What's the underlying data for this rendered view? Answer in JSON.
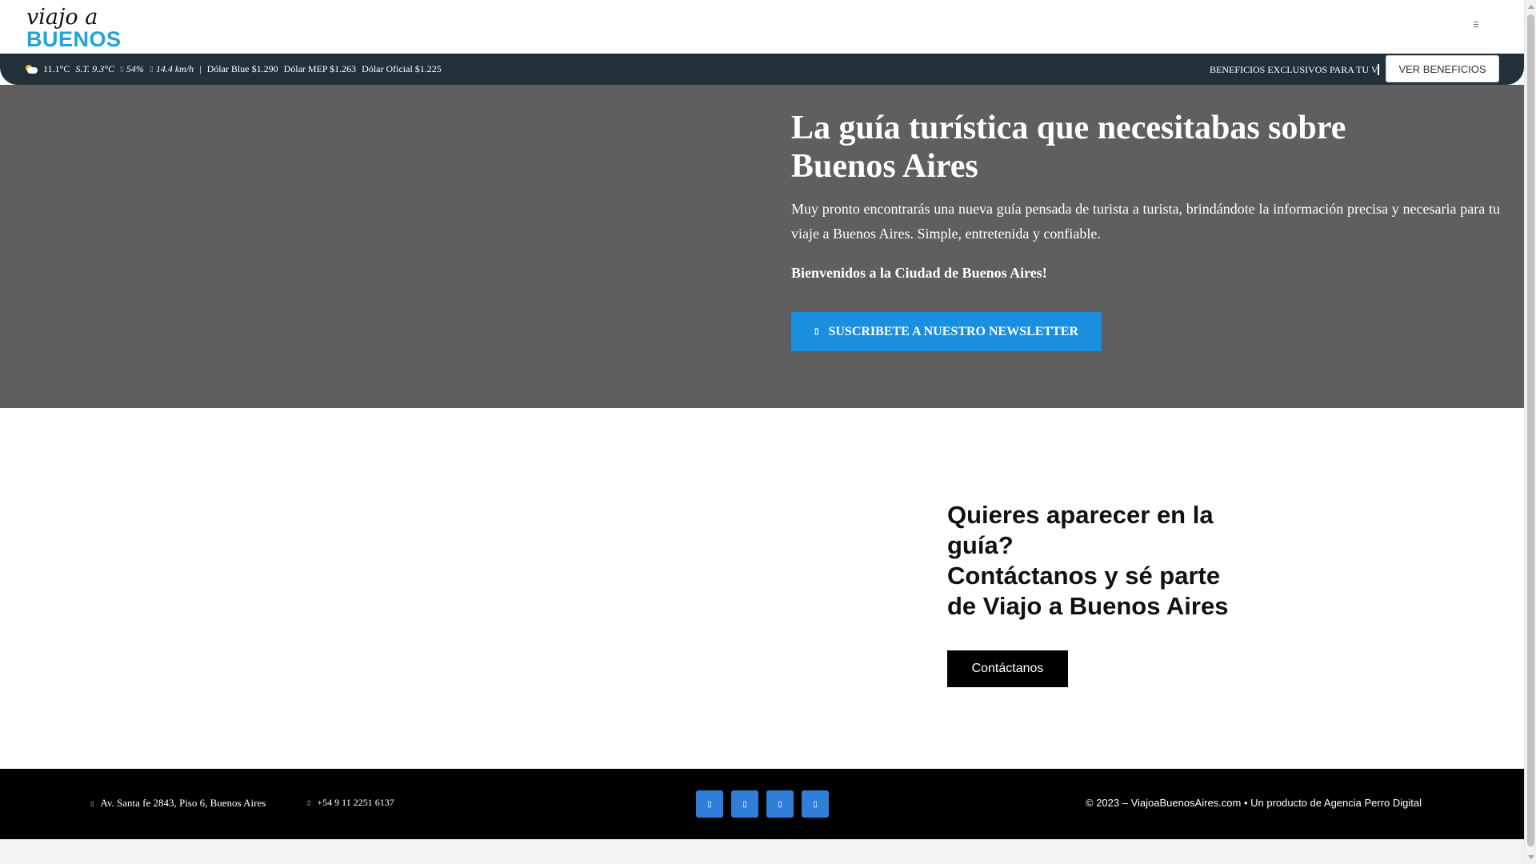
{
  "header": {
    "logo_script": "viajo a",
    "logo_block": "BUENOS AIRES",
    "menu_icon": "hamburger-icon"
  },
  "topbar": {
    "temperature": "11.1°C",
    "feels_like": "S.T. 9.3°C",
    "humidity": "54%",
    "wind": "14.4 km/h",
    "separator": "|",
    "dolar_blue": "Dólar Blue $1.290",
    "dolar_mep": "Dólar MEP $1.263",
    "dolar_oficial": "Dólar Oficial $1.225",
    "ticker_text": "BENEFICIOS EXCLUSIVOS PARA TU VIAJE",
    "cta_label": "VER BENEFICIOS"
  },
  "hero": {
    "title": "La guía turística que necesitabas sobre Buenos Aires",
    "text": "Muy pronto encontrarás una nueva guía pensada de turista a turista, brindándote la información precisa y necesaria para tu viaje a Buenos Aires.  Simple, entretenida y confiable.",
    "welcome": "Bienvenidos a la Ciudad de Buenos Aires!",
    "newsletter_label": "SUSCRIBETE A NUESTRO NEWSLETTER"
  },
  "contact": {
    "title_line1": "Quieres aparecer en la guía?",
    "title_line2": "Contáctanos y sé parte de Viajo a Buenos Aires",
    "button_label": "Contáctanos"
  },
  "footer": {
    "address": "Av. Santa fe 2843, Piso 6, Buenos Aires",
    "phone": "+54 9 11 2251 6137",
    "socials": [
      "facebook-icon",
      "instagram-icon",
      "twitter-icon",
      "youtube-icon"
    ],
    "copyright": "© 2023 – ViajoaBuenosAires.com • Un producto de Agencia Perro Digital"
  },
  "colors": {
    "topbar_bg": "#22303a",
    "hero_bg": "#5f5f5f",
    "newsletter_blue": "#1a8fe0",
    "social_blue": "#2f7fd8",
    "logo_blue": "#1fa3dd"
  }
}
